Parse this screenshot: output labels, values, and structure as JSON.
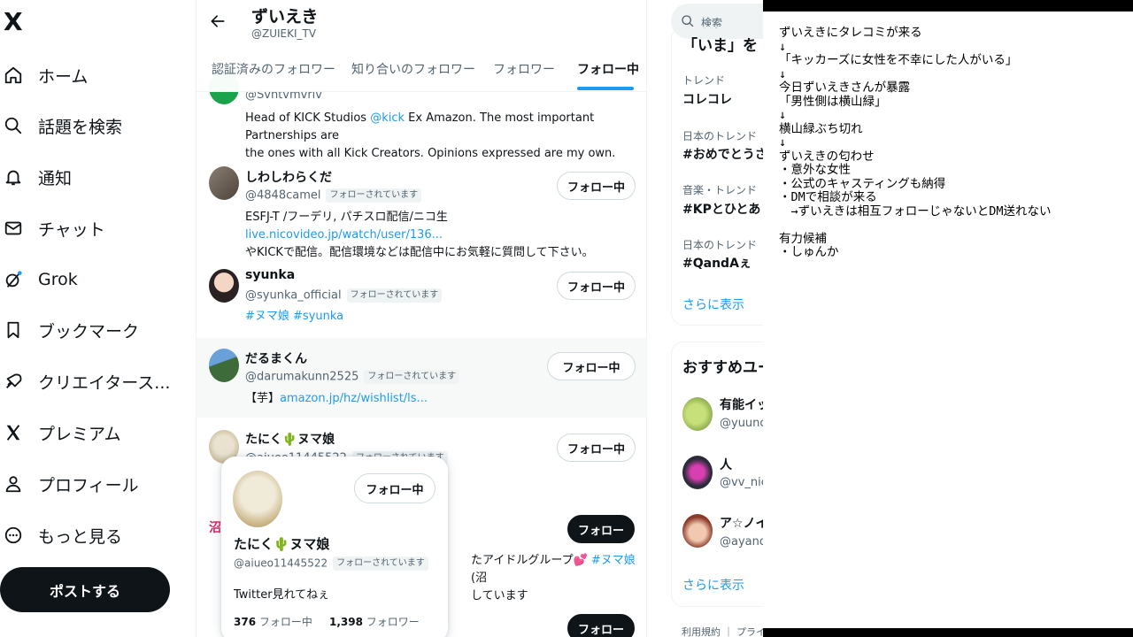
{
  "sidebar": {
    "logo": "X",
    "items": [
      {
        "label": "ホーム",
        "icon": "home-icon"
      },
      {
        "label": "話題を検索",
        "icon": "search-icon"
      },
      {
        "label": "通知",
        "icon": "bell-icon"
      },
      {
        "label": "チャット",
        "icon": "mail-icon"
      },
      {
        "label": "Grok",
        "icon": "grok-icon"
      },
      {
        "label": "ブックマーク",
        "icon": "bookmark-icon"
      },
      {
        "label": "クリエイタース...",
        "icon": "rocket-icon"
      },
      {
        "label": "プレミアム",
        "icon": "x-logo-icon"
      },
      {
        "label": "プロフィール",
        "icon": "person-icon"
      },
      {
        "label": "もっと見る",
        "icon": "more-circle-icon"
      }
    ],
    "post_button": "ポストする"
  },
  "header": {
    "name": "ずいえき",
    "handle": "@ZUIEKI_TV",
    "tabs": [
      "認証済みのフォロワー",
      "知り合いのフォロワー",
      "フォロワー",
      "フォロー中"
    ],
    "active_tab": "フォロー中"
  },
  "users": [
    {
      "handle": "@Svntvmvriv",
      "bio_1": "Head of KICK Studios ",
      "bio_link": "@kick",
      "bio_2": " Ex Amazon. The most important Partnerships are",
      "bio_3": "the ones with all Kick Creators. Opinions expressed are my own."
    },
    {
      "name": "しわしわらくだ",
      "handle": "@4848camel",
      "badge": "フォローされています",
      "bio_1": "ESFJ-T /フーデリ, パチスロ配信/ニコ生 ",
      "bio_link": "live.nicovideo.jp/watch/user/136...",
      "bio_2": "やKICKで配信。配信環境などは配信中にお気軽に質問して下さい。",
      "button": "フォロー中"
    },
    {
      "name": "syunka",
      "handle": "@syunka_official",
      "badge": "フォローされています",
      "bio_link": "#ヌマ娘 #syunka",
      "button": "フォロー中"
    },
    {
      "name": "だるまくん",
      "handle": "@darumakunn2525",
      "badge": "フォローされています",
      "bio_1": "【芋】",
      "bio_link": "amazon.jp/hz/wishlist/ls...",
      "button": "フォロー中"
    },
    {
      "name": "たにく🌵ヌマ娘",
      "handle": "@aiueo11445522",
      "badge": "フォローされています",
      "button": "フォロー中"
    },
    {
      "name_partial": "沼",
      "bio_1": "たアイドルグループ💕 ",
      "bio_link": "#ヌマ娘",
      "bio_2": " (沼",
      "bio_3": "しています",
      "button": "フォロー"
    },
    {
      "button": "フォロー"
    }
  ],
  "hovercard": {
    "name": "たにく🌵ヌマ娘",
    "handle": "@aiueo11445522",
    "badge": "フォローされています",
    "button": "フォロー中",
    "bio": "Twitter見れてねぇ",
    "following_count": "376",
    "following_label": "フォロー中",
    "followers_count": "1,398",
    "followers_label": "フォロワー"
  },
  "right": {
    "search_placeholder": "検索",
    "trends_title": "「いま」を",
    "trends": [
      {
        "meta": "トレンド",
        "name": "コレコレ"
      },
      {
        "meta": "日本のトレンド",
        "name": "#おめでとうさく"
      },
      {
        "meta": "音楽・トレンド",
        "name": "#KPとひとあし"
      },
      {
        "meta": "日本のトレンド",
        "name": "#QandAぇ"
      }
    ],
    "show_more": "さらに表示",
    "recommend_title": "おすすめユー",
    "recommend": [
      {
        "name": "有能イッ",
        "handle": "@yuunoi"
      },
      {
        "name": "人",
        "handle": "@vv_nico"
      },
      {
        "name": "ア☆ノイ",
        "handle": "@ayanoi"
      }
    ],
    "show_more_2": "さらに表示",
    "footer": "利用規約 ｜ プライバ"
  },
  "notes": {
    "text": "ずいえきにタレコミが来る\n↓\n「キッカーズに女性を不幸にした人がいる」\n↓\n今日ずいえきさんが暴露\n「男性側は横山緑」\n↓\n横山緑ぶち切れ\n↓\nずいえきの匂わせ\n・意外な女性\n・公式のキャスティングも納得\n・DMで相談が来る\n　→ずいえきは相互フォローじゃないとDM送れない\n\n有力候補\n・しゅんか"
  },
  "colors": {
    "accent": "#1d9bf0",
    "text": "#0f1419",
    "muted": "#536471",
    "border": "#cfd9de",
    "grok_dot": "#1d9bf0"
  }
}
